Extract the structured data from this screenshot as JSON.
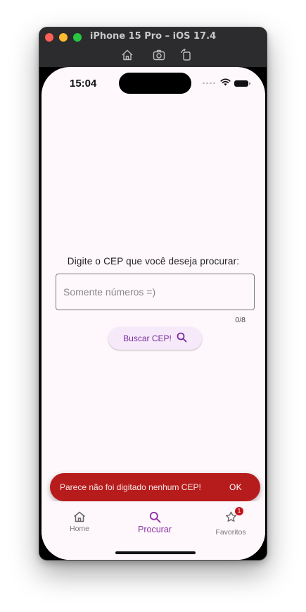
{
  "window": {
    "title": "iPhone 15 Pro – iOS 17.4"
  },
  "status_bar": {
    "time": "15:04"
  },
  "search": {
    "prompt": "Digite o CEP que você deseja procurar:",
    "placeholder": "Somente números =)",
    "value": "",
    "counter": "0/8",
    "button_label": "Buscar CEP!"
  },
  "snackbar": {
    "message": "Parece não foi digitado nenhum CEP!",
    "action": "OK"
  },
  "nav": {
    "items": [
      {
        "label": "Home",
        "icon": "home-icon"
      },
      {
        "label": "Procurar",
        "icon": "search-icon",
        "active": true
      },
      {
        "label": "Favoritos",
        "icon": "star-icon",
        "badge": "1"
      }
    ]
  },
  "colors": {
    "accent": "#8e35a6",
    "snackbar": "#b71c1c",
    "background": "#fef7fc"
  }
}
